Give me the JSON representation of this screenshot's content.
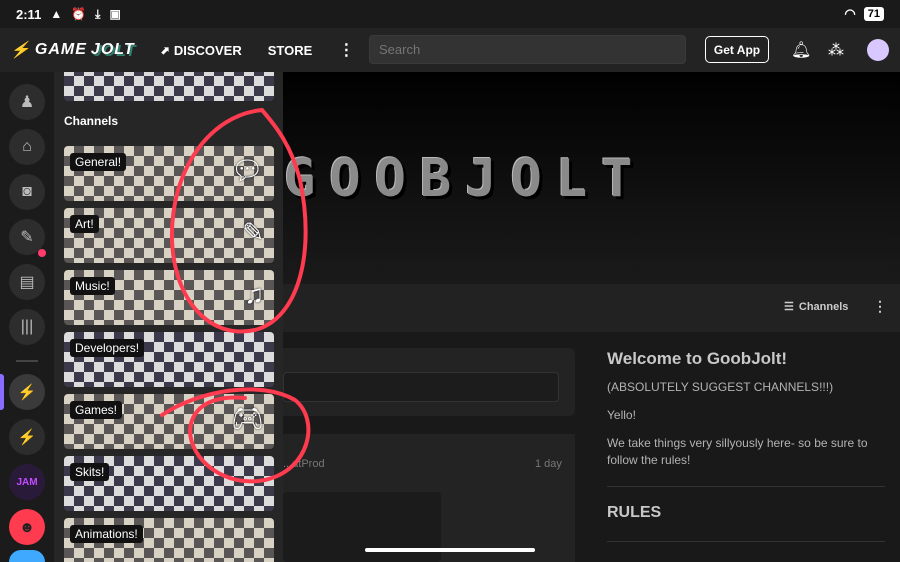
{
  "status_bar": {
    "time": "2:11",
    "battery": "71"
  },
  "nav": {
    "logo_game": "GAME",
    "logo_jolt": "JOLT",
    "discover": "DISCOVER",
    "store": "STORE",
    "more": "⋮",
    "search_placeholder": "Search",
    "get_app": "Get App"
  },
  "drawer": {
    "heading": "Channels",
    "channels": [
      {
        "label": "General!",
        "icon": "chat-bubble-icon"
      },
      {
        "label": "Art!",
        "icon": "paintbrush-icon"
      },
      {
        "label": "Music!",
        "icon": "music-note-icon"
      },
      {
        "label": "Developers!",
        "icon": ""
      },
      {
        "label": "Games!",
        "icon": "gamepad-icon"
      },
      {
        "label": "Skits!",
        "icon": ""
      },
      {
        "label": "Animations!",
        "icon": ""
      }
    ]
  },
  "banner": {
    "text": "GOOBJOLT"
  },
  "subbar": {
    "channels_label": "Channels",
    "more": "⋮"
  },
  "feed": {
    "author": "...atProd",
    "age": "1 day"
  },
  "sidebar": {
    "title": "Welcome to GoobJolt!",
    "line1": "(ABSOLUTELY SUGGEST CHANNELS!!!)",
    "line2": "Yello!",
    "line3": "We take things very sillyously here- so be sure to follow the rules!",
    "rules_heading": "RULES"
  },
  "colors": {
    "accent": "#ccff00",
    "annotation": "#ff3b4f",
    "brand_purple": "#6a3fbf"
  }
}
